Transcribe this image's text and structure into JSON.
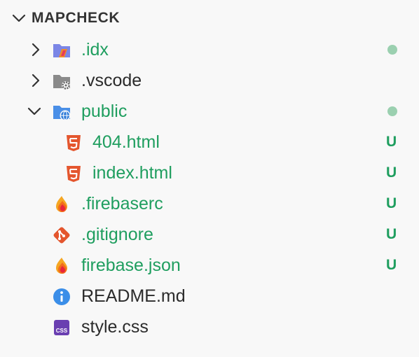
{
  "explorer": {
    "title": "MAPCHECK",
    "items": [
      {
        "label": ".idx",
        "icon": "folder-idx-icon",
        "status": "dot"
      },
      {
        "label": ".vscode",
        "icon": "folder-vscode-icon",
        "status": ""
      },
      {
        "label": "public",
        "icon": "folder-public-icon",
        "status": "dot"
      },
      {
        "label": "404.html",
        "icon": "html5-icon",
        "badge": "U"
      },
      {
        "label": "index.html",
        "icon": "html5-icon",
        "badge": "U"
      },
      {
        "label": ".firebaserc",
        "icon": "firebase-icon",
        "badge": "U"
      },
      {
        "label": ".gitignore",
        "icon": "git-icon",
        "badge": "U"
      },
      {
        "label": "firebase.json",
        "icon": "firebase-icon",
        "badge": "U"
      },
      {
        "label": "README.md",
        "icon": "info-icon",
        "badge": ""
      },
      {
        "label": "style.css",
        "icon": "css-icon",
        "badge": ""
      }
    ]
  },
  "colors": {
    "untracked": "#1f9e5f",
    "modified_dot": "#9bd0b0",
    "text": "#2b2b2b",
    "background": "#f8f8f8"
  }
}
